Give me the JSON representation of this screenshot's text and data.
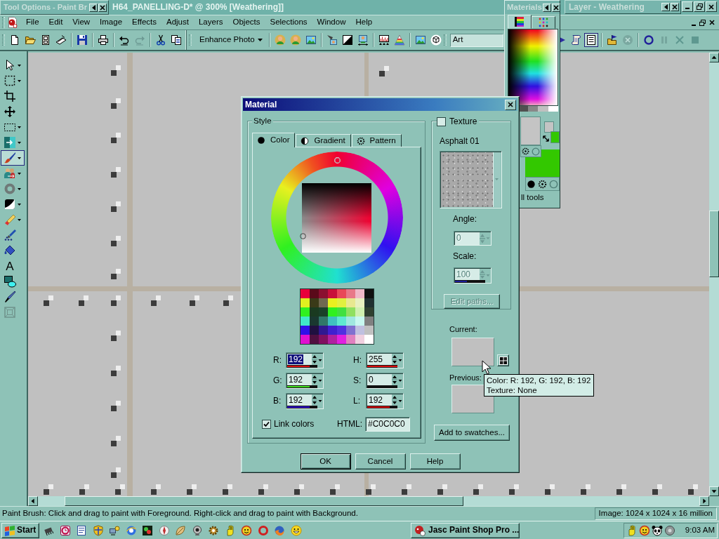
{
  "window": {
    "title": "H64_PANELLING-D* @ 300% [Weathering]]"
  },
  "tool_options_palette": {
    "title": "Tool Options - Paint Br"
  },
  "layer_palette": {
    "title": "Layer - Weathering"
  },
  "menu": [
    "File",
    "Edit",
    "View",
    "Image",
    "Effects",
    "Adjust",
    "Layers",
    "Objects",
    "Selections",
    "Window",
    "Help"
  ],
  "toolbar": {
    "enhance_photo": "Enhance Photo",
    "preset": "Art",
    "toggles": [
      {
        "on": false
      },
      {
        "on": true
      }
    ]
  },
  "tools": [
    {
      "menu": true,
      "selected": false,
      "disabled": false
    },
    {
      "menu": true,
      "selected": false,
      "disabled": false
    },
    {
      "menu": false,
      "selected": false,
      "disabled": false
    },
    {
      "menu": false,
      "selected": false,
      "disabled": false
    },
    {
      "menu": true,
      "selected": false,
      "disabled": false
    },
    {
      "menu": true,
      "selected": false,
      "disabled": false
    },
    {
      "menu": true,
      "selected": true,
      "disabled": false
    },
    {
      "menu": true,
      "selected": false,
      "disabled": false
    },
    {
      "menu": true,
      "selected": false,
      "disabled": false
    },
    {
      "menu": true,
      "selected": false,
      "disabled": false
    },
    {
      "menu": true,
      "selected": false,
      "disabled": false
    },
    {
      "menu": false,
      "selected": false,
      "disabled": false
    },
    {
      "menu": false,
      "selected": false,
      "disabled": false
    },
    {
      "glyph": "A",
      "menu": false,
      "selected": false,
      "disabled": false
    },
    {
      "menu": false,
      "selected": false,
      "disabled": false
    },
    {
      "menu": false,
      "selected": false,
      "disabled": false
    },
    {
      "menu": false,
      "selected": false,
      "disabled": true
    }
  ],
  "materials_palette": {
    "title": "Materials",
    "tabs": [
      {
        "selected": true
      },
      {
        "selected": false
      }
    ],
    "swatches": [
      {
        "color": "#c4c4c4"
      },
      {
        "color": "#c4c4c4"
      },
      {
        "color": "#33c800"
      },
      {
        "color": "#33c800"
      }
    ],
    "footer": "ll tools"
  },
  "dialog": {
    "title": "Material",
    "style": {
      "legend": "Style",
      "tabs": [
        {
          "label": "Color",
          "selected": true
        },
        {
          "label": "Gradient",
          "selected": false
        },
        {
          "label": "Pattern",
          "selected": false
        }
      ],
      "swatches": [
        {
          "color": "#e8003a"
        },
        {
          "color": "#5a0a1a"
        },
        {
          "color": "#8a1030"
        },
        {
          "color": "#c8103a"
        },
        {
          "color": "#e84858"
        },
        {
          "color": "#e87888"
        },
        {
          "color": "#f0b8c8"
        },
        {
          "color": "#101010"
        },
        {
          "color": "#e0f020"
        },
        {
          "color": "#3a3a18"
        },
        {
          "color": "#706850"
        },
        {
          "color": "#e8f020"
        },
        {
          "color": "#e0f040"
        },
        {
          "color": "#e8e890"
        },
        {
          "color": "#e8f0c0"
        },
        {
          "color": "#203030"
        },
        {
          "color": "#30f020"
        },
        {
          "color": "#1a3a20"
        },
        {
          "color": "#1a4028"
        },
        {
          "color": "#30f020"
        },
        {
          "color": "#40e040"
        },
        {
          "color": "#90e060"
        },
        {
          "color": "#d0f0b0"
        },
        {
          "color": "#304030"
        },
        {
          "color": "#40e8c8"
        },
        {
          "color": "#1a3830"
        },
        {
          "color": "#307868"
        },
        {
          "color": "#40c0c0"
        },
        {
          "color": "#60e8d0"
        },
        {
          "color": "#a0e8e0"
        },
        {
          "color": "#c8f8f0"
        },
        {
          "color": "#808080"
        },
        {
          "color": "#3010e8"
        },
        {
          "color": "#201040"
        },
        {
          "color": "#301890"
        },
        {
          "color": "#4020d0"
        },
        {
          "color": "#5030e0"
        },
        {
          "color": "#8070d0"
        },
        {
          "color": "#c0c0e0"
        },
        {
          "color": "#c0c0c0"
        },
        {
          "color": "#e010d0"
        },
        {
          "color": "#501040"
        },
        {
          "color": "#801060"
        },
        {
          "color": "#b020a0"
        },
        {
          "color": "#e020e0"
        },
        {
          "color": "#e080c0"
        },
        {
          "color": "#f0d0e0"
        },
        {
          "color": "#ffffff"
        }
      ],
      "rgb": [
        {
          "label": "R:",
          "value": "192",
          "color": "#e01010",
          "level": 0.75,
          "text_selected": true
        },
        {
          "label": "G:",
          "value": "192",
          "color": "#40e020",
          "level": 0.75,
          "text_selected": false
        },
        {
          "label": "B:",
          "value": "192",
          "color": "#3010d0",
          "level": 0.75,
          "text_selected": false
        }
      ],
      "hsl": [
        {
          "label": "H:",
          "value": "255",
          "color": "#e01010",
          "level": 1,
          "text_selected": false
        },
        {
          "label": "S:",
          "value": "0",
          "level": 0,
          "text_selected": false
        },
        {
          "label": "L:",
          "value": "192",
          "color": "#e01010",
          "level": 0.75,
          "text_selected": false
        }
      ],
      "link_colors": {
        "label": "Link colors",
        "checked": true
      },
      "html": {
        "label": "HTML:",
        "value": "#C0C0C0"
      }
    },
    "texture": {
      "label": "Texture",
      "checked": false,
      "name": "Asphalt 01",
      "angle": {
        "label": "Angle:",
        "value": "0",
        "disabled": true
      },
      "scale": {
        "label": "Scale:",
        "value": "100",
        "disabled": true,
        "level": 0.4
      },
      "edit_paths": {
        "label": "Edit paths...",
        "disabled": true
      }
    },
    "current": {
      "label": "Current:",
      "color": "#c0c0c0"
    },
    "previous": {
      "label": "Previous:",
      "color": "#c0c0c0"
    },
    "add_to_swatches": "Add to swatches...",
    "buttons": [
      {
        "label": "OK",
        "default": true
      },
      {
        "label": "Cancel",
        "default": false
      },
      {
        "label": "Help",
        "default": false
      }
    ]
  },
  "tooltip": [
    "Color: R: 192, G: 192, B: 192",
    "Texture: None"
  ],
  "status_bar": {
    "hint": "Paint Brush: Click and drag to paint with Foreground. Right-click and drag to paint with Background.",
    "image_info": "Image: 1024 x 1024 x 16 million"
  },
  "taskbar": {
    "start": "Start",
    "task": "Jasc Paint Shop Pro ...",
    "clock": "9:03 AM"
  }
}
